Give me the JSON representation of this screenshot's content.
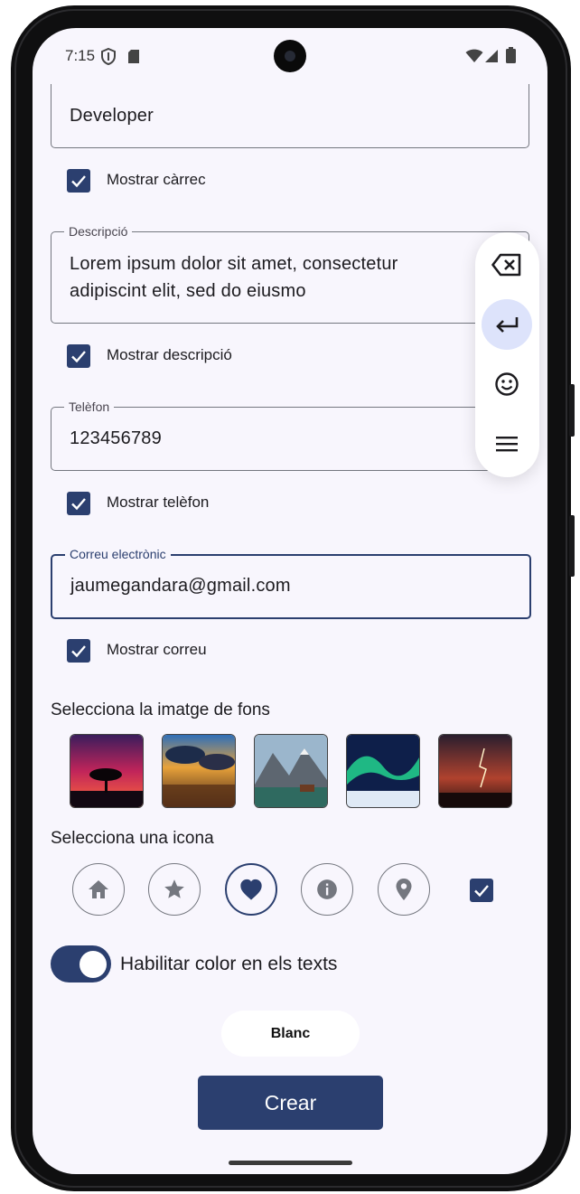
{
  "status_bar": {
    "time": "7:15",
    "icons": [
      "shield-icon",
      "sd-card-icon",
      "wifi-icon",
      "signal-icon",
      "battery-icon"
    ]
  },
  "form": {
    "role_field": {
      "value": "Developer"
    },
    "show_role": {
      "label": "Mostrar càrrec",
      "checked": true
    },
    "description_field": {
      "label": "Descripció",
      "value_line1": "Lorem ipsum dolor sit amet, consectetur",
      "value_line2": "adipiscint elit, sed do eiusmo"
    },
    "show_description": {
      "label": "Mostrar descripció",
      "checked": true
    },
    "phone_field": {
      "label": "Telèfon",
      "value": "123456789"
    },
    "show_phone": {
      "label": "Mostrar telèfon",
      "checked": true
    },
    "email_field": {
      "label": "Correu electrònic",
      "value": "jaumegandara@gmail.com"
    },
    "show_email": {
      "label": "Mostrar correu",
      "checked": true
    }
  },
  "background_section": {
    "title": "Selecciona la imatge de fons",
    "images": [
      "sunset-tree-image",
      "cloudy-sunset-lake-image",
      "mountain-lake-image",
      "aurora-image",
      "lightning-storm-image"
    ]
  },
  "icon_section": {
    "title": "Selecciona una icona",
    "icons": [
      "home-icon",
      "star-icon",
      "heart-icon",
      "info-icon",
      "location-pin-icon"
    ],
    "selected": "heart-icon",
    "checkbox_checked": true
  },
  "color_toggle": {
    "label": "Habilitar color en els texts",
    "enabled": true
  },
  "color_button": {
    "label": "Blanc"
  },
  "create_button": {
    "label": "Crear"
  },
  "floating_keyboard": {
    "keys": [
      "backspace-icon",
      "enter-icon",
      "emoji-icon",
      "menu-icon"
    ],
    "active": "enter-icon"
  },
  "colors": {
    "primary": "#2b3f6f",
    "background": "#f8f6fd",
    "key_highlight": "#dde3fb"
  }
}
